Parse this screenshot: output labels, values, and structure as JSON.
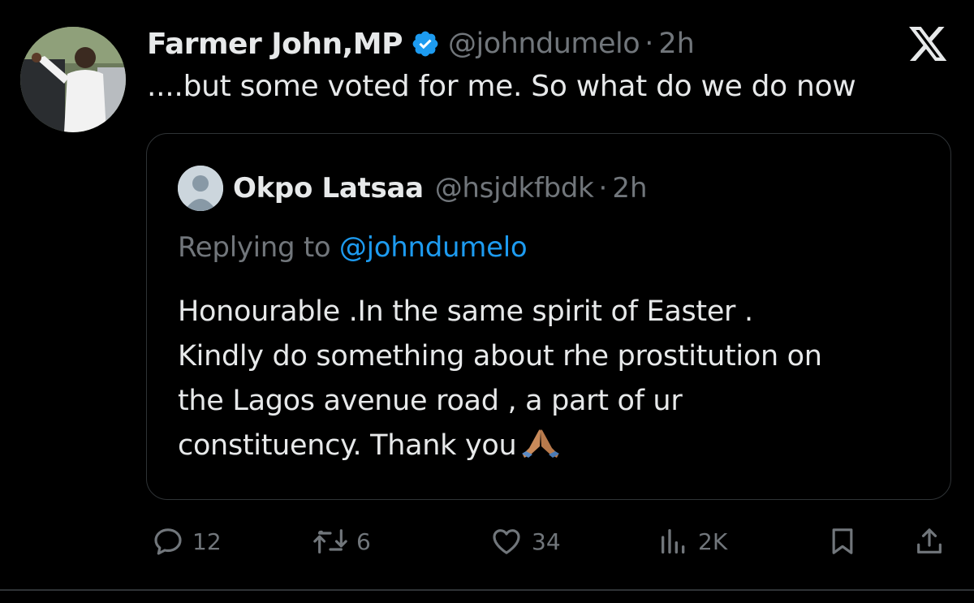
{
  "tweet": {
    "author_name": "Farmer John,MP",
    "author_handle": "@johndumelo",
    "separator": "·",
    "time": "2h",
    "text": "....but some voted for me. So what do we do now"
  },
  "quoted_tweet": {
    "author_name": "Okpo Latsaa",
    "author_handle": "@hsjdkfbdk",
    "separator": "·",
    "time": "2h",
    "replying_prefix": "Replying to",
    "replying_to": "@johndumelo",
    "body_lines": [
      "Honourable .In the same spirit of Easter .",
      "Kindly do something about rhe prostitution on",
      "the Lagos avenue road , a part of ur",
      "constituency. Thank you"
    ]
  },
  "actions": {
    "replies": "12",
    "reposts": "6",
    "likes": "34",
    "views": "2K"
  },
  "colors": {
    "background": "#000000",
    "text": "#e7e9ea",
    "muted": "#71767b",
    "accent": "#1d9bf0",
    "border": "#2f3336"
  },
  "icons": [
    "x-logo-icon",
    "verified-badge-icon",
    "reply-icon",
    "repost-icon",
    "like-icon",
    "views-icon",
    "bookmark-icon",
    "share-icon",
    "folded-hands-emoji-icon"
  ]
}
